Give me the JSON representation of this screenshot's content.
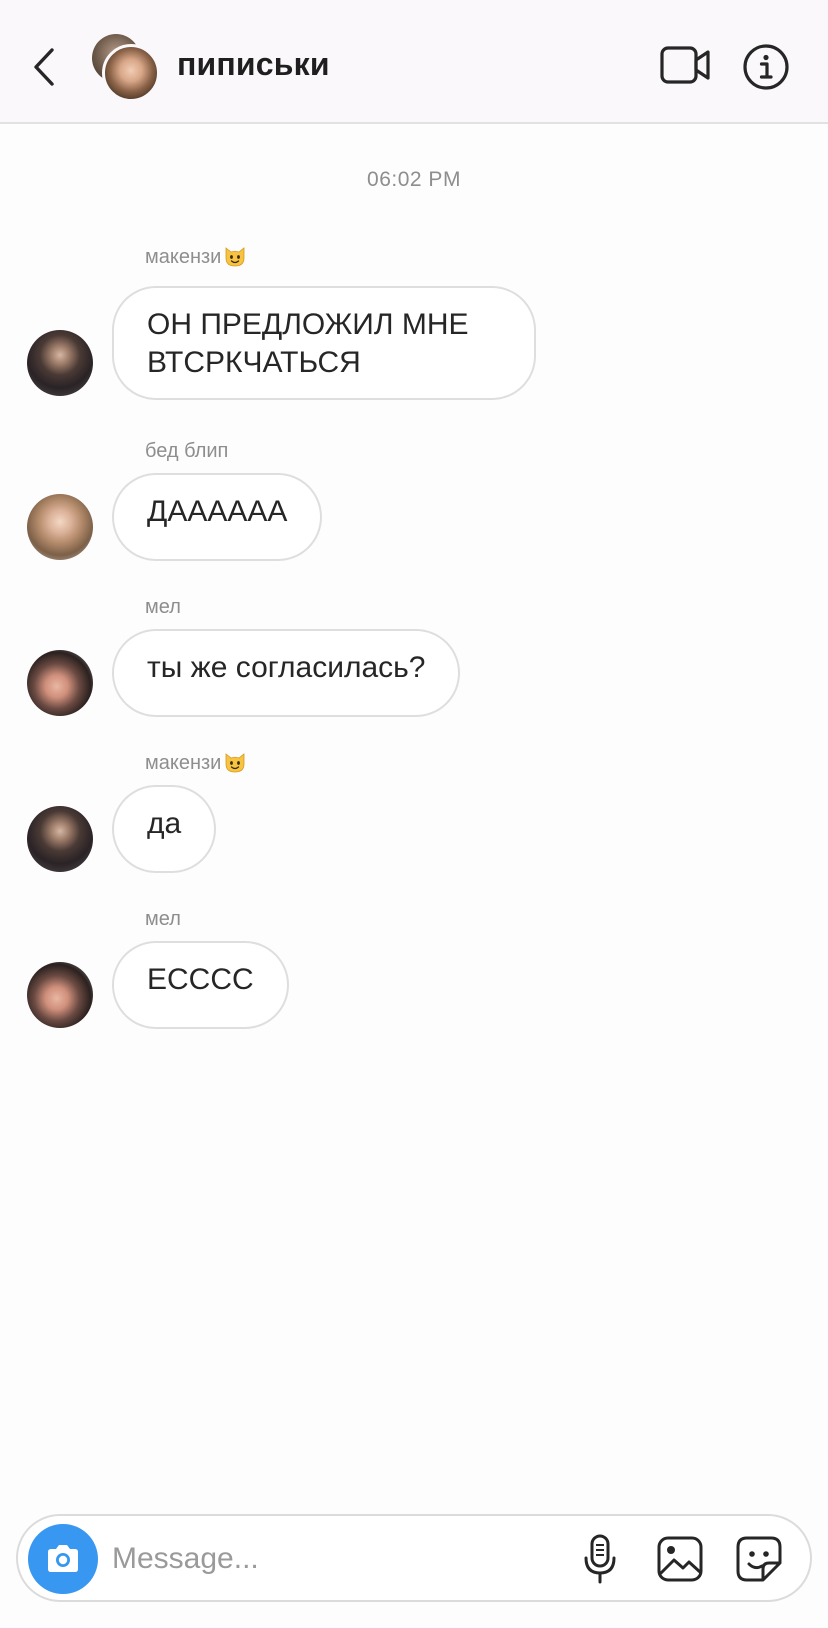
{
  "header": {
    "title": "пиписьки",
    "back_icon": "chevron-left-icon",
    "video_icon": "video-camera-icon",
    "info_icon": "info-icon"
  },
  "thread": {
    "timestamp": "06:02 PM",
    "messages": [
      {
        "sender": "макензи",
        "sender_emoji": "cat-face-icon",
        "text": "ОН ПРЕДЛОЖИЛ МНЕ ВТСРКЧАТЬСЯ"
      },
      {
        "sender": "бед блип",
        "text": "ДАААААА"
      },
      {
        "sender": "мел",
        "text": "ты же согласилась?"
      },
      {
        "sender": "макензи",
        "sender_emoji": "cat-face-icon",
        "text": "да"
      },
      {
        "sender": "мел",
        "text": "ЕССCC"
      }
    ]
  },
  "composer": {
    "placeholder": "Message...",
    "value": "",
    "camera_icon": "camera-icon",
    "mic_icon": "microphone-icon",
    "gallery_icon": "image-gallery-icon",
    "sticker_icon": "sticker-icon"
  },
  "colors": {
    "accent": "#3897f0",
    "bubble_border": "#dedede",
    "meta_text": "#8e8e8e",
    "header_bg": "#faf8fb"
  }
}
